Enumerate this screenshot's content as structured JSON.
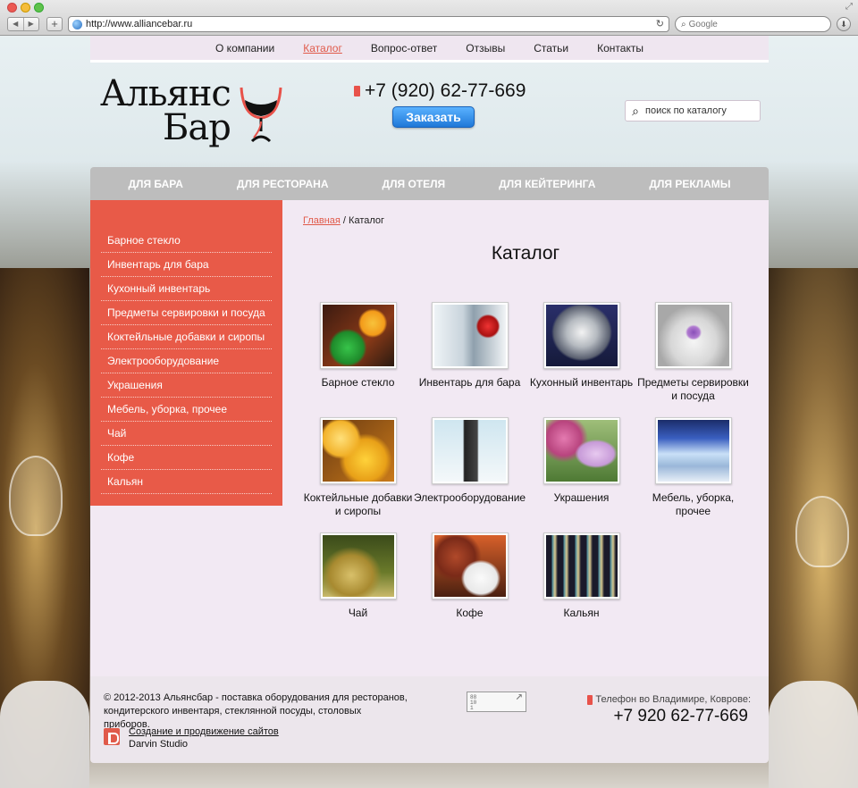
{
  "browser": {
    "url": "http://www.alliancebar.ru",
    "search_placeholder": "Google"
  },
  "top_nav": [
    "О компании",
    "Каталог",
    "Вопрос-ответ",
    "Отзывы",
    "Статьи",
    "Контакты"
  ],
  "top_nav_active": "Каталог",
  "logo": {
    "line1": "Альянс",
    "line2": "Бар"
  },
  "phone": "+7 (920) 62-77-669",
  "order_button": "Заказать",
  "site_search_placeholder": "поиск по каталогу",
  "category_bar": [
    "ДЛЯ БАРА",
    "ДЛЯ РЕСТОРАНА",
    "ДЛЯ ОТЕЛЯ",
    "ДЛЯ КЕЙТЕРИНГА",
    "ДЛЯ РЕКЛАМЫ"
  ],
  "sidebar": [
    "Барное стекло",
    "Инвентарь для бара",
    "Кухонный инвентарь",
    "Предметы сервировки и посуда",
    "Коктейльные добавки и сиропы",
    "Электрооборудование",
    "Украшения",
    "Мебель, уборка, прочее",
    "Чай",
    "Кофе",
    "Кальян"
  ],
  "breadcrumb": {
    "home": "Главная",
    "separator": " / ",
    "current": "Каталог"
  },
  "page_title": "Каталог",
  "catalog": [
    {
      "label": "Барное стекло",
      "image": "bar-glass-photo"
    },
    {
      "label": "Инвентарь для бара",
      "image": "bar-tools-photo"
    },
    {
      "label": "Кухонный инвентарь",
      "image": "cookware-photo"
    },
    {
      "label": "Предметы сервировки и посуда",
      "image": "tableware-photo"
    },
    {
      "label": "Коктейльные добавки и сиропы",
      "image": "cocktail-photo"
    },
    {
      "label": "Электрооборудование",
      "image": "mixer-photo"
    },
    {
      "label": "Украшения",
      "image": "flowers-candle-photo"
    },
    {
      "label": "Мебель, уборка, прочее",
      "image": "bar-interior-photo"
    },
    {
      "label": "Чай",
      "image": "tea-photo"
    },
    {
      "label": "Кофе",
      "image": "coffee-photo"
    },
    {
      "label": "Кальян",
      "image": "hookah-photo"
    }
  ],
  "footer": {
    "copyright_line1": "© 2012-2013 Альянсбар - поставка оборудования для ресторанов,",
    "copyright_line2": "кондитерского инвентаря, стеклянной посуды, столовых приборов.",
    "studio_link": "Создание и продвижение сайтов",
    "studio_name": "Darvin Studio",
    "phone_label": "Телефон во Владимире, Коврове:",
    "phone": "+7 920 62-77-669",
    "counter_text": "88\n10\n1"
  },
  "colors": {
    "accent": "#e85a48",
    "content_bg": "#f2e9f3",
    "category_bar": "#bdbdbd",
    "order_button": "#1f78d8"
  }
}
